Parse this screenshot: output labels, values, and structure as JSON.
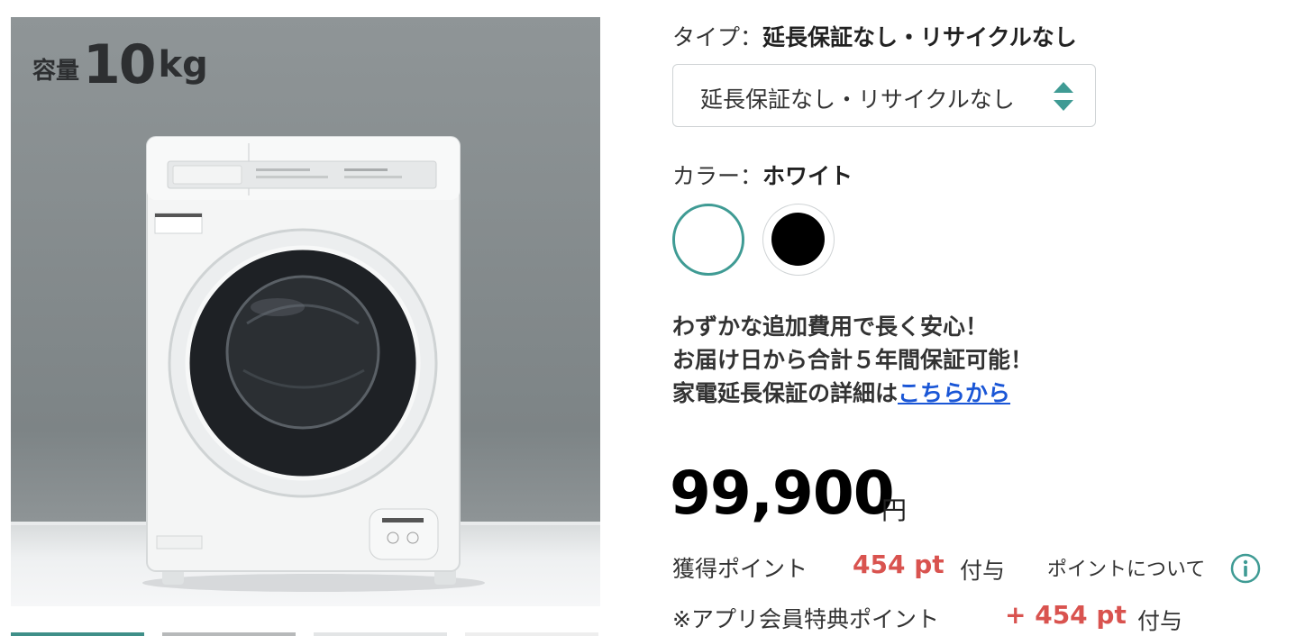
{
  "product_image": {
    "capacity_label": "容量",
    "capacity_number": "10",
    "capacity_unit": "kg",
    "icon": "washing-machine-photo"
  },
  "thumbnails": {
    "count": 4,
    "active_index": 0
  },
  "type_option": {
    "label": "タイプ：",
    "selected_name": "延長保証なし・リサイクルなし",
    "select_value": "延長保証なし・リサイクルなし",
    "arrows_icon": "up-down-arrows-icon"
  },
  "color_option": {
    "label": "カラー：",
    "selected_name": "ホワイト",
    "swatches": [
      {
        "name": "white",
        "color": "#ffffff",
        "selected": true
      },
      {
        "name": "black",
        "color": "#000000",
        "selected": false
      }
    ]
  },
  "promo": {
    "line1": "わずかな追加費用で長く安心！",
    "line2": "お届け日から合計５年間保証可能！",
    "line3_text": "家電延長保証の詳細は",
    "line3_link": "こちらから"
  },
  "price": {
    "value": "99,900",
    "currency": "円"
  },
  "points": {
    "label": "獲得ポイント",
    "value": "454 pt",
    "suffix": "付与",
    "about_link": "ポイントについて",
    "info_icon": "info-icon"
  },
  "app_points": {
    "label": "※アプリ会員特典ポイント",
    "value": "+ 454 pt",
    "suffix": "付与"
  },
  "colors": {
    "accent": "#3f9b94",
    "points_red": "#d9534f",
    "link_blue": "#1a56d6"
  }
}
